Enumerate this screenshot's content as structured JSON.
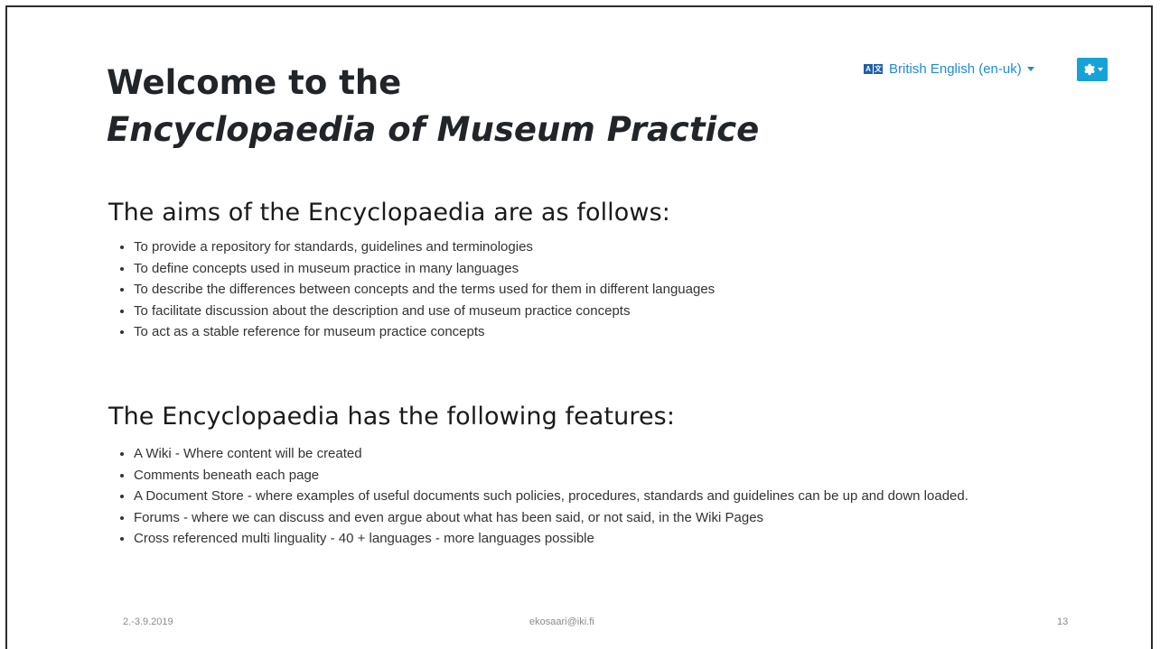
{
  "header": {
    "title_line1": "Welcome to the",
    "title_line2": "Encyclopaedia of Museum Practice"
  },
  "toolbar": {
    "language_label": "British English (en-uk)",
    "flag_letters": [
      "A",
      "文"
    ]
  },
  "section_aims": {
    "heading": "The aims of the Encyclopaedia are as follows:",
    "items": [
      "To provide a repository for standards, guidelines and terminologies",
      "To define concepts used in museum practice in many languages",
      "To describe the differences between concepts and the terms used for them in different languages",
      "To facilitate discussion about the description and use of museum practice concepts",
      "To act as a stable reference for museum practice concepts"
    ]
  },
  "section_features": {
    "heading": "The Encyclopaedia has the following features:",
    "items": [
      "A Wiki - Where content will be created",
      "Comments beneath each page",
      "A Document Store - where examples of useful documents such policies, procedures, standards and guidelines can be up and down loaded.",
      "Forums - where we can discuss and even argue about what has been said, or not said, in the Wiki Pages",
      "Cross referenced multi linguality - 40 + languages - more languages possible"
    ]
  },
  "footer": {
    "date": "2.-3.9.2019",
    "email": "ekosaari@iki.fi",
    "page_number": "13"
  },
  "colors": {
    "link_blue": "#1f8ad6",
    "button_blue": "#17a2d6"
  }
}
